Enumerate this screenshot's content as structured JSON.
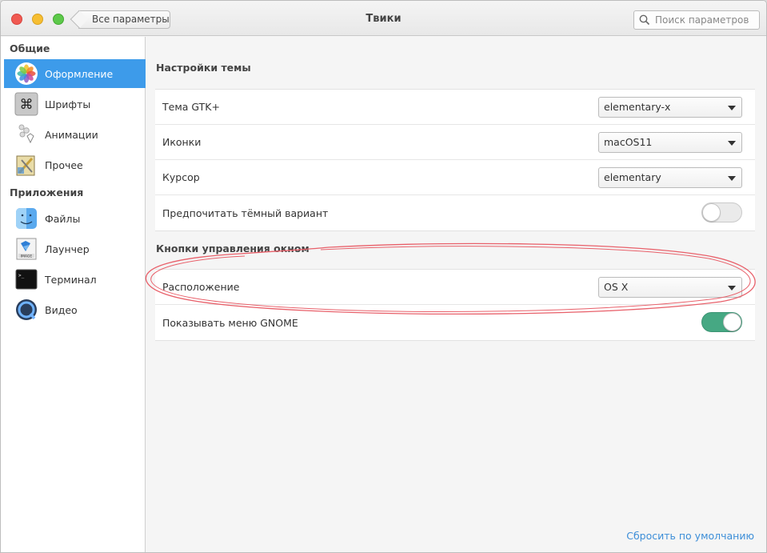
{
  "window": {
    "title": "Твики",
    "back_label": "Все параметры",
    "search_placeholder": "Поиск параметров"
  },
  "sidebar": {
    "sections": [
      {
        "header": "Общие",
        "items": [
          {
            "label": "Оформление",
            "icon": "photos-flower-icon",
            "active": true
          },
          {
            "label": "Шрифты",
            "icon": "command-key-icon",
            "active": false
          },
          {
            "label": "Анимации",
            "icon": "animation-bubbles-icon",
            "active": false
          },
          {
            "label": "Прочее",
            "icon": "misc-tools-icon",
            "active": false
          }
        ]
      },
      {
        "header": "Приложения",
        "items": [
          {
            "label": "Файлы",
            "icon": "finder-icon",
            "active": false
          },
          {
            "label": "Лаунчер",
            "icon": "launcher-image-icon",
            "active": false
          },
          {
            "label": "Терминал",
            "icon": "terminal-icon",
            "active": false
          },
          {
            "label": "Видео",
            "icon": "quicktime-icon",
            "active": false
          }
        ]
      }
    ]
  },
  "main": {
    "theme_group": {
      "title": "Настройки темы",
      "rows": [
        {
          "label": "Тема GTK+",
          "value": "elementary-x"
        },
        {
          "label": "Иконки",
          "value": "macOS11"
        },
        {
          "label": "Курсор",
          "value": "elementary"
        },
        {
          "label": "Предпочитать тёмный вариант",
          "toggle": false
        }
      ]
    },
    "window_controls_group": {
      "title": "Кнопки управления окном",
      "rows": [
        {
          "label": "Расположение",
          "value": "OS X"
        },
        {
          "label": "Показывать меню GNOME",
          "toggle": true
        }
      ]
    },
    "reset_label": "Сбросить по умолчанию"
  },
  "colors": {
    "accent": "#3d9bea",
    "toggle_on": "#46a883",
    "annotation": "#e8606a",
    "link": "#3d8ed8"
  }
}
